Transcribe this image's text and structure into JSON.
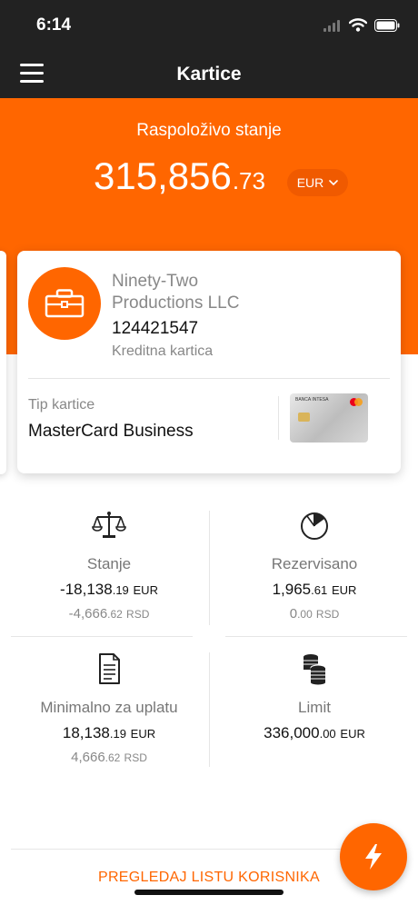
{
  "status_bar": {
    "time": "6:14"
  },
  "header": {
    "title": "Kartice"
  },
  "balance": {
    "label": "Raspoloživo stanje",
    "main": "315,856",
    "decimal": ".73",
    "currency": "EUR"
  },
  "card": {
    "owner_line1": "Ninety-Two",
    "owner_line2": "Productions LLC",
    "number": "124421547",
    "kind": "Kreditna kartica",
    "type_label": "Tip kartice",
    "type_value": "MasterCard Business",
    "thumb_bank": "BANCA INTESA"
  },
  "stats": [
    {
      "icon": "scale-icon",
      "label": "Stanje",
      "primary_main": "-18,138",
      "primary_dec": ".19",
      "primary_cur": "EUR",
      "secondary_main": "-4,666",
      "secondary_dec": ".62",
      "secondary_cur": "RSD"
    },
    {
      "icon": "pie-chart-icon",
      "label": "Rezervisano",
      "primary_main": "1,965",
      "primary_dec": ".61",
      "primary_cur": "EUR",
      "secondary_main": "0",
      "secondary_dec": ".00",
      "secondary_cur": "RSD"
    },
    {
      "icon": "document-icon",
      "label": "Minimalno za uplatu",
      "primary_main": "18,138",
      "primary_dec": ".19",
      "primary_cur": "EUR",
      "secondary_main": "4,666",
      "secondary_dec": ".62",
      "secondary_cur": "RSD"
    },
    {
      "icon": "coins-icon",
      "label": "Limit",
      "primary_main": "336,000",
      "primary_dec": ".00",
      "primary_cur": "EUR"
    }
  ],
  "footer": {
    "link_label": "PREGLEDAJ LISTU KORISNIKA"
  },
  "colors": {
    "accent": "#ff6600",
    "header_bg": "#222222"
  }
}
